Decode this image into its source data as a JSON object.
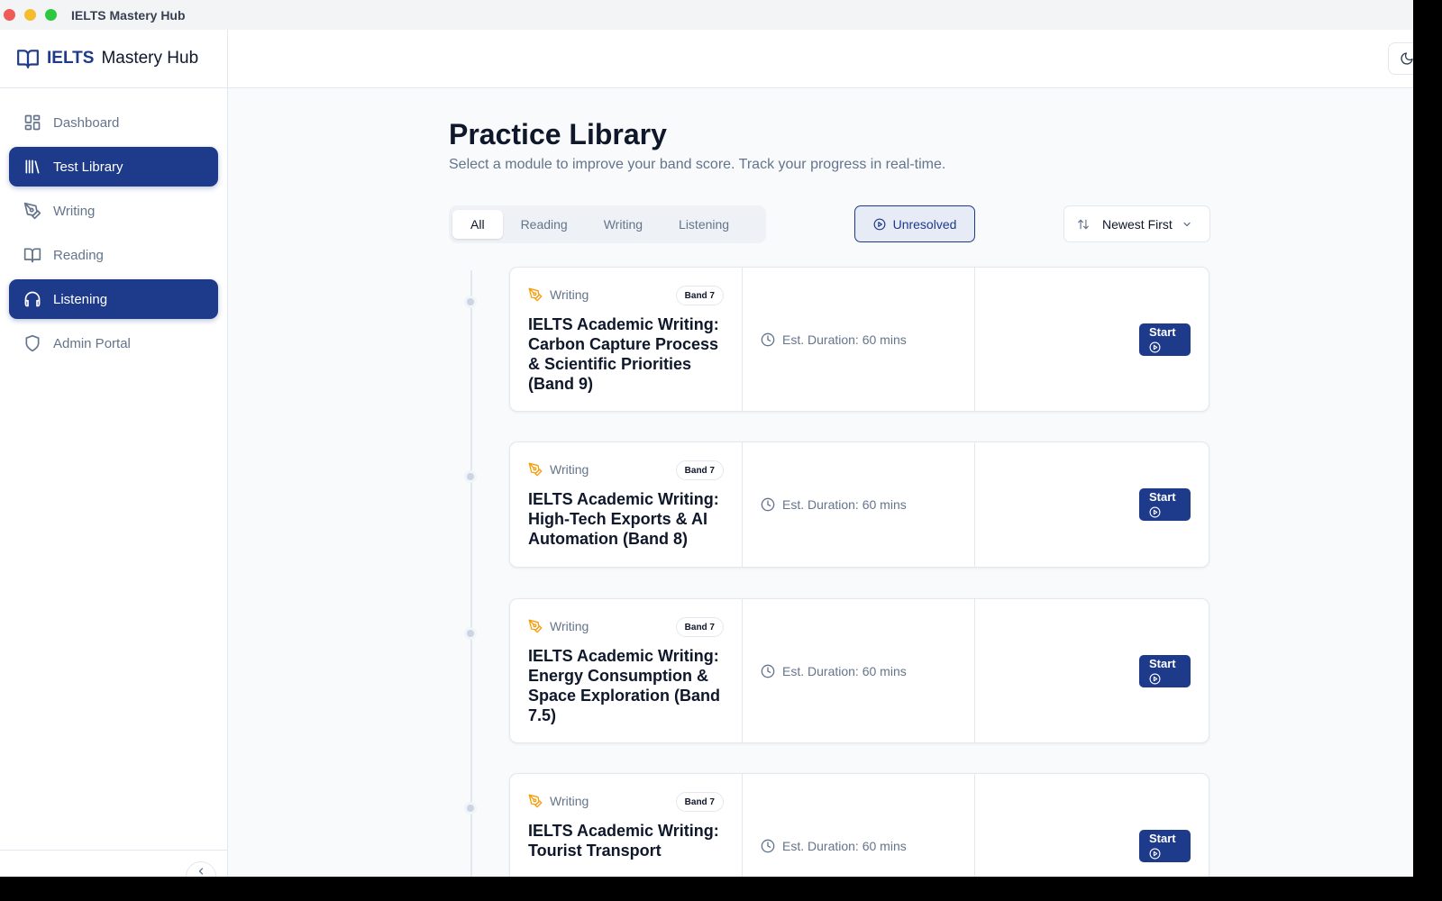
{
  "window": {
    "title": "IELTS Mastery Hub"
  },
  "brand": {
    "strong": "IELTS",
    "rest": "Mastery Hub"
  },
  "sidebar": {
    "items": [
      {
        "label": "Dashboard",
        "icon": "dashboard-icon",
        "active": false
      },
      {
        "label": "Test Library",
        "icon": "library-icon",
        "active": true
      },
      {
        "label": "Writing",
        "icon": "pen-icon",
        "active": false
      },
      {
        "label": "Reading",
        "icon": "book-icon",
        "active": false
      },
      {
        "label": "Listening",
        "icon": "headphones-icon",
        "active": true
      },
      {
        "label": "Admin Portal",
        "icon": "shield-icon",
        "active": false
      }
    ]
  },
  "header": {
    "theme_toggle_icon": "moon-icon"
  },
  "main": {
    "title": "Practice Library",
    "subtitle": "Select a module to improve your band score. Track your progress in real-time.",
    "tabs": [
      {
        "label": "All",
        "active": true
      },
      {
        "label": "Reading",
        "active": false
      },
      {
        "label": "Writing",
        "active": false
      },
      {
        "label": "Listening",
        "active": false
      }
    ],
    "filter_label": "Unresolved",
    "sort_label": "Newest First"
  },
  "cards": [
    {
      "category": "Writing",
      "band": "Band 7",
      "title": "IELTS Academic Writing: Carbon Capture Process & Scientific Priorities (Band 9)",
      "duration": "Est. Duration: 60 mins",
      "action": "Start"
    },
    {
      "category": "Writing",
      "band": "Band 7",
      "title": "IELTS Academic Writing: High-Tech Exports & AI Automation (Band 8)",
      "duration": "Est. Duration: 60 mins",
      "action": "Start"
    },
    {
      "category": "Writing",
      "band": "Band 7",
      "title": "IELTS Academic Writing: Energy Consumption & Space Exploration (Band 7.5)",
      "duration": "Est. Duration: 60 mins",
      "action": "Start"
    },
    {
      "category": "Writing",
      "band": "Band 7",
      "title": "IELTS Academic Writing: Tourist Transport",
      "duration": "Est. Duration: 60 mins",
      "action": "Start"
    }
  ],
  "colors": {
    "accent": "#1e3a8a",
    "writing_icon": "#f59e0b",
    "muted": "#64748b"
  }
}
